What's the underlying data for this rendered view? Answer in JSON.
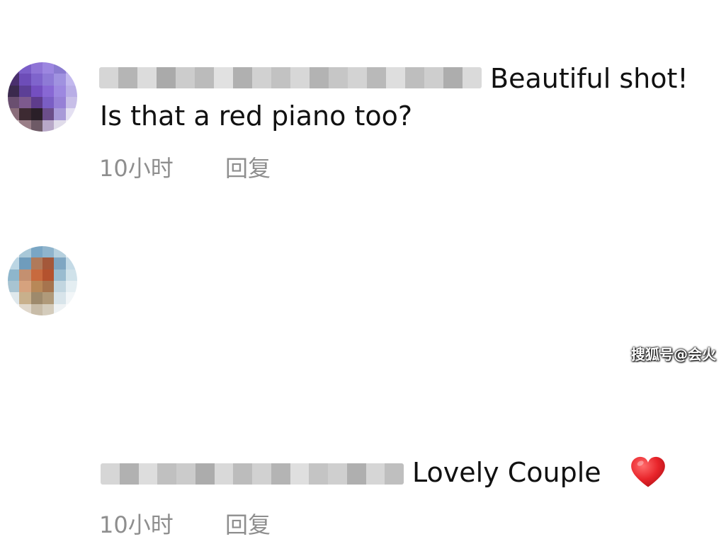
{
  "comments": [
    {
      "text_after_name": "Beautiful shot!",
      "text_line2": "Is that a red piano too?",
      "time": "10小时",
      "reply_label": "回复",
      "avatar_colors": [
        "#5a3a8a",
        "#7b5ec8",
        "#8f74d6",
        "#9c86e0",
        "#8a7bd0",
        "#b4a6e6",
        "#4a2f6e",
        "#6d4db8",
        "#7f64cc",
        "#8e7ad6",
        "#a092e0",
        "#c2b8ee",
        "#3b2a4e",
        "#5c3f96",
        "#744fc0",
        "#8868d4",
        "#9d88e0",
        "#b9aee6",
        "#6a4f70",
        "#7d5a8e",
        "#5e3c8c",
        "#7a5ec4",
        "#9680d6",
        "#c8bfe8",
        "#8a6d7a",
        "#3d2a32",
        "#2a1f28",
        "#6b4e8a",
        "#a89ad8",
        "#e4e0f2",
        "#c9b8bc",
        "#9a7f88",
        "#6e5a66",
        "#b8a8c8",
        "#e0dcea",
        "#f4f2f8"
      ],
      "name_blur_colors": [
        "#cfcfcf",
        "#a9a9a9",
        "#d6d6d6",
        "#9c9c9c",
        "#c4c4c4",
        "#b0b0b0",
        "#dcdcdc",
        "#a3a3a3",
        "#c9c9c9",
        "#b8b8b8",
        "#d1d1d1",
        "#a6a6a6",
        "#bdbdbd",
        "#cccccc",
        "#adadad",
        "#d9d9d9",
        "#b3b3b3",
        "#c6c6c6",
        "#9f9f9f",
        "#d4d4d4"
      ]
    },
    {
      "text_after_name": "Lovely Couple",
      "time": "10小时",
      "reply_label": "回复",
      "avatar_colors": [
        "#e8eef2",
        "#a9c8d8",
        "#7aa6c4",
        "#8fb4cc",
        "#b6d0de",
        "#e6eef2",
        "#bcd6e4",
        "#6f9cbc",
        "#b07a5a",
        "#a4583a",
        "#7fa6c2",
        "#c4dae6",
        "#8eb6cc",
        "#c49070",
        "#c86a3e",
        "#b4522e",
        "#9abcd0",
        "#d0e2ea",
        "#a8c4d2",
        "#d6a27e",
        "#b88858",
        "#a6744e",
        "#c2d6e0",
        "#e4eef2",
        "#dfe8ec",
        "#c8b08c",
        "#9e8a6c",
        "#b09a7a",
        "#d8e4ea",
        "#f2f6f8",
        "#f4f6f8",
        "#e0d8cc",
        "#c8bca8",
        "#d4ccbc",
        "#eef2f4",
        "#fafbfc"
      ],
      "name_blur_colors": [
        "#cfcfcf",
        "#a4a4a4",
        "#d8d8d8",
        "#b6b6b6",
        "#c2c2c2",
        "#9e9e9e",
        "#d3d3d3",
        "#b1b1b1",
        "#cacaca",
        "#a8a8a8",
        "#dadada",
        "#bababa",
        "#c7c7c7",
        "#a2a2a2",
        "#d0d0d0",
        "#b4b4b4"
      ]
    }
  ],
  "heart_color": "#e8242a",
  "watermark": "搜狐号@会火"
}
